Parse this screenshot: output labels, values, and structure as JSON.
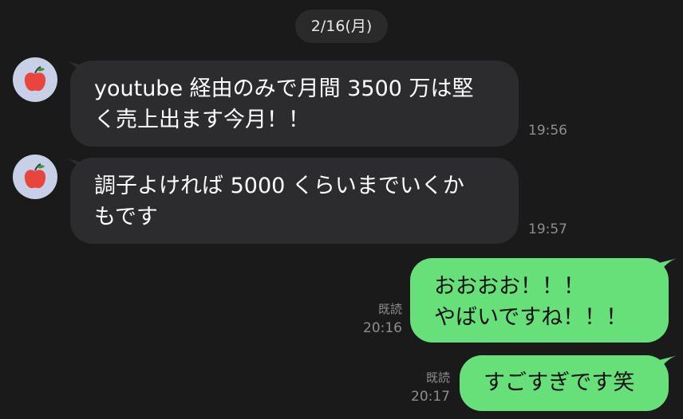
{
  "date_separator": "2/16(月)",
  "messages": [
    {
      "side": "incoming",
      "lines": [
        "youtube 経由のみで月間 3500 万は堅",
        "く売上出ます今月！！"
      ],
      "time": "19:56"
    },
    {
      "side": "incoming",
      "lines": [
        "調子よければ 5000 くらいまでいくか",
        "もです"
      ],
      "time": "19:57"
    },
    {
      "side": "outgoing",
      "lines": [
        "おおおお！！！",
        "やばいですね！！！"
      ],
      "read": "既読",
      "time": "20:16"
    },
    {
      "side": "outgoing",
      "lines": [
        "すごすぎです笑"
      ],
      "read": "既読",
      "time": "20:17"
    }
  ],
  "colors": {
    "background": "#1a1a1a",
    "incoming_bubble": "#2c2c2e",
    "outgoing_bubble": "#67e07a",
    "avatar_bg": "#c7d0e6",
    "apple_red": "#e8453c",
    "apple_leaf": "#3a9a3a",
    "meta_text": "#8e8e8e"
  },
  "icons": {
    "avatar": "apple-icon"
  }
}
